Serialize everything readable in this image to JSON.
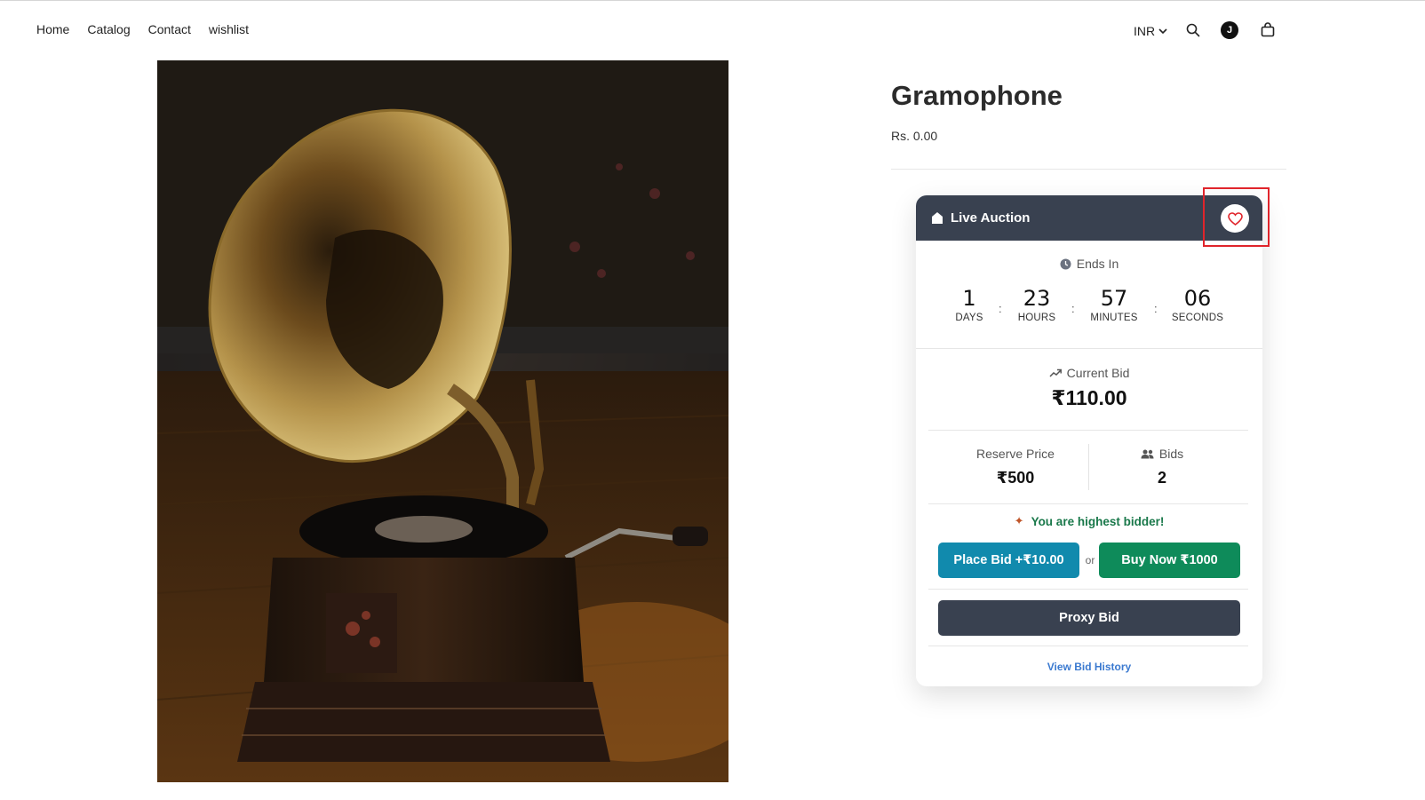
{
  "nav": {
    "items": [
      {
        "label": "Home"
      },
      {
        "label": "Catalog"
      },
      {
        "label": "Contact"
      },
      {
        "label": "wishlist"
      }
    ]
  },
  "header": {
    "currency": "INR",
    "avatar_initial": "J"
  },
  "product": {
    "title": "Gramophone",
    "price": "Rs. 0.00"
  },
  "auction": {
    "header_label": "Live Auction",
    "ends_in_label": "Ends In",
    "countdown": [
      {
        "value": "1",
        "label": "DAYS"
      },
      {
        "value": "23",
        "label": "HOURS"
      },
      {
        "value": "57",
        "label": "MINUTES"
      },
      {
        "value": "06",
        "label": "SECONDS"
      }
    ],
    "separator": ":",
    "current_bid_label": "Current Bid",
    "current_bid_value": "₹110.00",
    "reserve_label": "Reserve Price",
    "reserve_value": "₹500",
    "bids_label": "Bids",
    "bids_value": "2",
    "highest_bidder_text": "You are highest bidder!",
    "place_bid_label": "Place Bid +₹10.00",
    "or_label": "or",
    "buy_now_label": "Buy Now ₹1000",
    "proxy_bid_label": "Proxy Bid",
    "history_link": "View Bid History"
  },
  "colors": {
    "card_header": "#394150",
    "place_bid": "#118aad",
    "buy_now": "#0e8b5a",
    "highest_text": "#19784a",
    "link": "#3b7ad0",
    "highlight": "#e0242b"
  }
}
